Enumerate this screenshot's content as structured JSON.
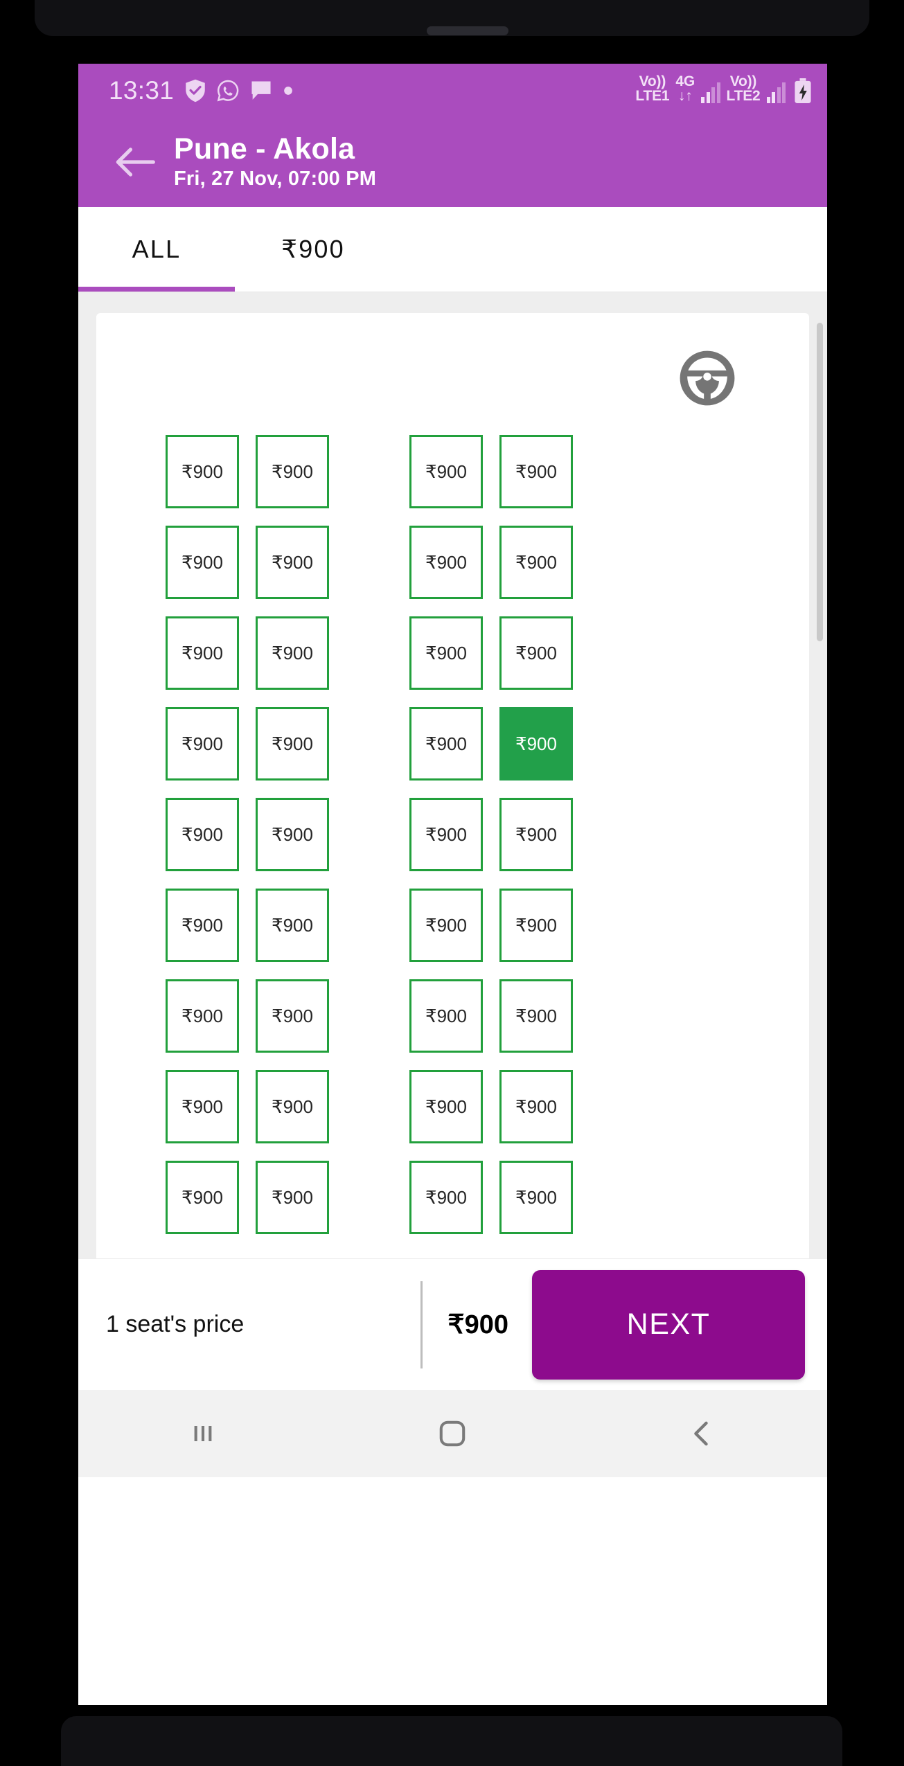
{
  "status_bar": {
    "clock": "13:31",
    "left_icons": [
      "shield-check-icon",
      "whatsapp-icon",
      "message-icon",
      "dot-icon"
    ],
    "sim1": {
      "volte_label": "Vo))",
      "network_label": "LTE1"
    },
    "data": {
      "type_label": "4G",
      "transfer_label": "↓↑"
    },
    "sim2": {
      "volte_label": "Vo))",
      "network_label": "LTE2"
    },
    "battery": "battery-charging-icon"
  },
  "app_bar": {
    "back_icon": "arrow-left-icon",
    "route_title": "Pune - Akola",
    "journey_datetime": "Fri, 27 Nov,  07:00 PM",
    "background_color": "#aa4cbe"
  },
  "tabs": [
    {
      "label": "ALL",
      "active": true
    },
    {
      "label": "₹900",
      "active": false
    }
  ],
  "deck": {
    "driver_icon": "steering-wheel-icon",
    "seat_label": "₹900",
    "seat_available_color": "#22a03c",
    "seat_selected_color": "#22a04a",
    "rows": [
      {
        "left": [
          "available",
          "available"
        ],
        "right": [
          "available",
          "available"
        ]
      },
      {
        "left": [
          "available",
          "available"
        ],
        "right": [
          "available",
          "available"
        ]
      },
      {
        "left": [
          "available",
          "available"
        ],
        "right": [
          "available",
          "available"
        ]
      },
      {
        "left": [
          "available",
          "available"
        ],
        "right": [
          "available",
          "selected"
        ]
      },
      {
        "left": [
          "available",
          "available"
        ],
        "right": [
          "available",
          "available"
        ]
      },
      {
        "left": [
          "available",
          "available"
        ],
        "right": [
          "available",
          "available"
        ]
      },
      {
        "left": [
          "available",
          "available"
        ],
        "right": [
          "available",
          "available"
        ]
      },
      {
        "left": [
          "available",
          "available"
        ],
        "right": [
          "available",
          "available"
        ]
      },
      {
        "left": [
          "available",
          "available"
        ],
        "right": [
          "available",
          "available"
        ]
      }
    ]
  },
  "bottom_bar": {
    "seat_count_label": "1 seat's price",
    "total_price": "₹900",
    "next_label": "NEXT",
    "next_color": "#8d0b8d"
  },
  "nav_bar": {
    "recents": "recents-icon",
    "home": "home-icon",
    "back": "back-icon"
  }
}
